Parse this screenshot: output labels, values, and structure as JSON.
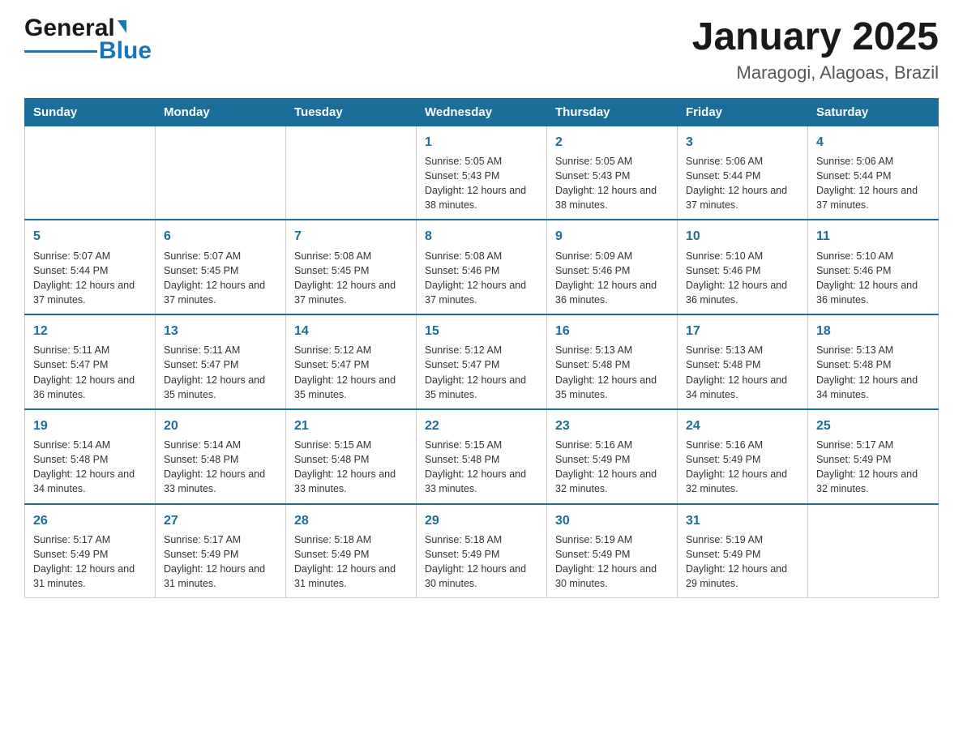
{
  "logo": {
    "general": "General",
    "blue": "Blue"
  },
  "title": {
    "month_year": "January 2025",
    "location": "Maragogi, Alagoas, Brazil"
  },
  "days_of_week": [
    "Sunday",
    "Monday",
    "Tuesday",
    "Wednesday",
    "Thursday",
    "Friday",
    "Saturday"
  ],
  "weeks": [
    [
      {
        "day": "",
        "content": ""
      },
      {
        "day": "",
        "content": ""
      },
      {
        "day": "",
        "content": ""
      },
      {
        "day": "1",
        "content": "Sunrise: 5:05 AM\nSunset: 5:43 PM\nDaylight: 12 hours and 38 minutes."
      },
      {
        "day": "2",
        "content": "Sunrise: 5:05 AM\nSunset: 5:43 PM\nDaylight: 12 hours and 38 minutes."
      },
      {
        "day": "3",
        "content": "Sunrise: 5:06 AM\nSunset: 5:44 PM\nDaylight: 12 hours and 37 minutes."
      },
      {
        "day": "4",
        "content": "Sunrise: 5:06 AM\nSunset: 5:44 PM\nDaylight: 12 hours and 37 minutes."
      }
    ],
    [
      {
        "day": "5",
        "content": "Sunrise: 5:07 AM\nSunset: 5:44 PM\nDaylight: 12 hours and 37 minutes."
      },
      {
        "day": "6",
        "content": "Sunrise: 5:07 AM\nSunset: 5:45 PM\nDaylight: 12 hours and 37 minutes."
      },
      {
        "day": "7",
        "content": "Sunrise: 5:08 AM\nSunset: 5:45 PM\nDaylight: 12 hours and 37 minutes."
      },
      {
        "day": "8",
        "content": "Sunrise: 5:08 AM\nSunset: 5:46 PM\nDaylight: 12 hours and 37 minutes."
      },
      {
        "day": "9",
        "content": "Sunrise: 5:09 AM\nSunset: 5:46 PM\nDaylight: 12 hours and 36 minutes."
      },
      {
        "day": "10",
        "content": "Sunrise: 5:10 AM\nSunset: 5:46 PM\nDaylight: 12 hours and 36 minutes."
      },
      {
        "day": "11",
        "content": "Sunrise: 5:10 AM\nSunset: 5:46 PM\nDaylight: 12 hours and 36 minutes."
      }
    ],
    [
      {
        "day": "12",
        "content": "Sunrise: 5:11 AM\nSunset: 5:47 PM\nDaylight: 12 hours and 36 minutes."
      },
      {
        "day": "13",
        "content": "Sunrise: 5:11 AM\nSunset: 5:47 PM\nDaylight: 12 hours and 35 minutes."
      },
      {
        "day": "14",
        "content": "Sunrise: 5:12 AM\nSunset: 5:47 PM\nDaylight: 12 hours and 35 minutes."
      },
      {
        "day": "15",
        "content": "Sunrise: 5:12 AM\nSunset: 5:47 PM\nDaylight: 12 hours and 35 minutes."
      },
      {
        "day": "16",
        "content": "Sunrise: 5:13 AM\nSunset: 5:48 PM\nDaylight: 12 hours and 35 minutes."
      },
      {
        "day": "17",
        "content": "Sunrise: 5:13 AM\nSunset: 5:48 PM\nDaylight: 12 hours and 34 minutes."
      },
      {
        "day": "18",
        "content": "Sunrise: 5:13 AM\nSunset: 5:48 PM\nDaylight: 12 hours and 34 minutes."
      }
    ],
    [
      {
        "day": "19",
        "content": "Sunrise: 5:14 AM\nSunset: 5:48 PM\nDaylight: 12 hours and 34 minutes."
      },
      {
        "day": "20",
        "content": "Sunrise: 5:14 AM\nSunset: 5:48 PM\nDaylight: 12 hours and 33 minutes."
      },
      {
        "day": "21",
        "content": "Sunrise: 5:15 AM\nSunset: 5:48 PM\nDaylight: 12 hours and 33 minutes."
      },
      {
        "day": "22",
        "content": "Sunrise: 5:15 AM\nSunset: 5:48 PM\nDaylight: 12 hours and 33 minutes."
      },
      {
        "day": "23",
        "content": "Sunrise: 5:16 AM\nSunset: 5:49 PM\nDaylight: 12 hours and 32 minutes."
      },
      {
        "day": "24",
        "content": "Sunrise: 5:16 AM\nSunset: 5:49 PM\nDaylight: 12 hours and 32 minutes."
      },
      {
        "day": "25",
        "content": "Sunrise: 5:17 AM\nSunset: 5:49 PM\nDaylight: 12 hours and 32 minutes."
      }
    ],
    [
      {
        "day": "26",
        "content": "Sunrise: 5:17 AM\nSunset: 5:49 PM\nDaylight: 12 hours and 31 minutes."
      },
      {
        "day": "27",
        "content": "Sunrise: 5:17 AM\nSunset: 5:49 PM\nDaylight: 12 hours and 31 minutes."
      },
      {
        "day": "28",
        "content": "Sunrise: 5:18 AM\nSunset: 5:49 PM\nDaylight: 12 hours and 31 minutes."
      },
      {
        "day": "29",
        "content": "Sunrise: 5:18 AM\nSunset: 5:49 PM\nDaylight: 12 hours and 30 minutes."
      },
      {
        "day": "30",
        "content": "Sunrise: 5:19 AM\nSunset: 5:49 PM\nDaylight: 12 hours and 30 minutes."
      },
      {
        "day": "31",
        "content": "Sunrise: 5:19 AM\nSunset: 5:49 PM\nDaylight: 12 hours and 29 minutes."
      },
      {
        "day": "",
        "content": ""
      }
    ]
  ]
}
